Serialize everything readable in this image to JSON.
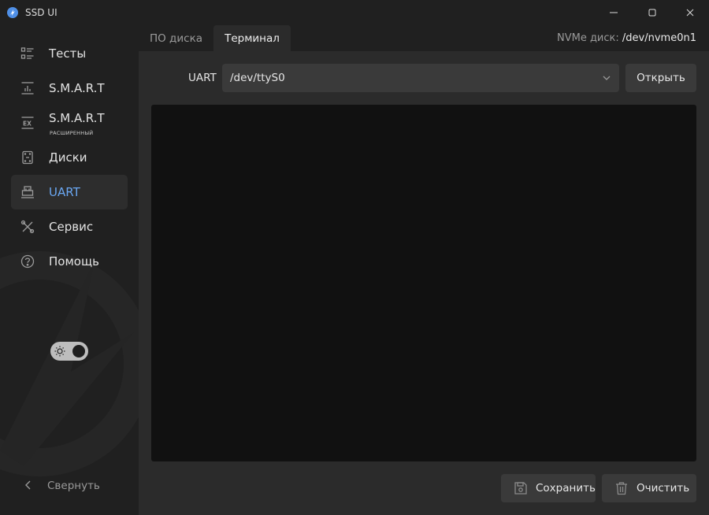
{
  "window": {
    "title": "SSD UI"
  },
  "sidebar": {
    "items": [
      {
        "label": "Тесты",
        "sublabel": ""
      },
      {
        "label": "S.M.A.R.T",
        "sublabel": ""
      },
      {
        "label": "S.M.A.R.T",
        "sublabel": "РАСШИРЕННЫЙ"
      },
      {
        "label": "Диски",
        "sublabel": ""
      },
      {
        "label": "UART",
        "sublabel": ""
      },
      {
        "label": "Сервис",
        "sublabel": ""
      },
      {
        "label": "Помощь",
        "sublabel": ""
      }
    ],
    "active_item": "UART",
    "collapse_label": "Свернуть"
  },
  "tabs": [
    {
      "label": "ПО диска"
    },
    {
      "label": "Терминал"
    }
  ],
  "active_tab": "Терминал",
  "disk": {
    "label": "NVMe диск:",
    "value": "/dev/nvme0n1"
  },
  "uart": {
    "label": "UART",
    "port_value": "/dev/ttyS0",
    "open_label": "Открыть"
  },
  "actions": {
    "save_label": "Сохранить",
    "clear_label": "Очистить"
  },
  "colors": {
    "accent": "#6aa7f2",
    "background": "#202020",
    "panel": "#2b2b2b",
    "terminal": "#111111"
  }
}
